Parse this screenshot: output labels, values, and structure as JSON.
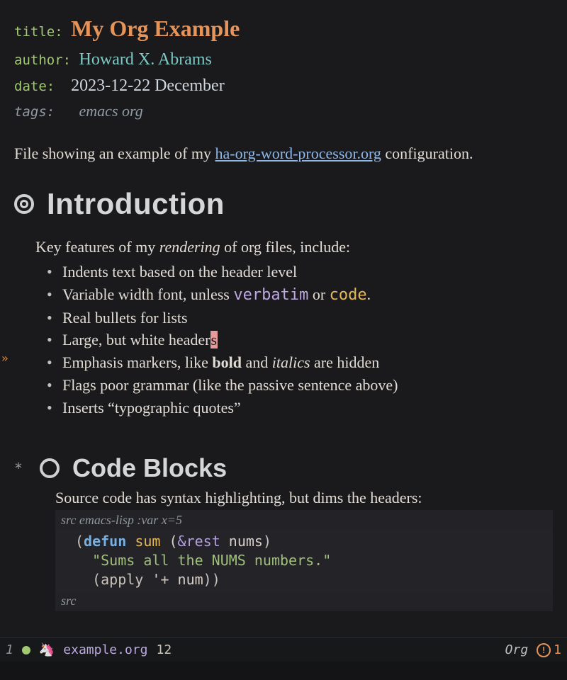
{
  "meta": {
    "title_key": "title",
    "title_val": "My Org Example",
    "author_key": "author",
    "author_val": "Howard X. Abrams",
    "date_key": "date",
    "date_val": "2023-12-22 December",
    "tags_key": "tags:",
    "tags_val": "emacs org"
  },
  "intro_para_pre": "File showing an example of my ",
  "intro_link": "ha-org-word-processor.org",
  "intro_para_post": " configuration.",
  "h1": "Introduction",
  "features_lead_pre": "Key features of my ",
  "features_lead_em": "rendering",
  "features_lead_post": " of org files, include:",
  "features": {
    "f0": "Indents text based on the header level",
    "f1_pre": "Variable width font, unless ",
    "f1_verb": "verbatim",
    "f1_mid": " or ",
    "f1_code": "code",
    "f1_post": ".",
    "f2": "Real bullets for lists",
    "f3_pre": "Large, but white header",
    "f3_cursor": "s",
    "f4_pre": "Emphasis markers, like ",
    "f4_bold": "bold",
    "f4_mid": " and ",
    "f4_ital": "italics",
    "f4_post": " are hidden",
    "f5": "Flags poor grammar (like the passive sentence above)",
    "f6": "Inserts “typographic quotes”"
  },
  "star": "*",
  "h2": "Code Blocks",
  "src_intro": "Source code has syntax highlighting, but dims the headers:",
  "src_header_prefix": "src",
  "src_header_lang": " emacs-lisp :var x=5",
  "src_footer": "src",
  "code": {
    "l1_open": "(",
    "l1_kw": "defun",
    "l1_sp": " ",
    "l1_fn": "sum",
    "l1_sp2": " (",
    "l1_amp": "&rest",
    "l1_sp3": " ",
    "l1_arg": "nums",
    "l1_close": ")",
    "l2": "\"Sums all the NUMS numbers.\"",
    "l3_open": "(",
    "l3_fn": "apply",
    "l3_sp": " '",
    "l3_plus": "+",
    "l3_sp2": " ",
    "l3_arg": "num",
    "l3_close": "))"
  },
  "modeline": {
    "win": "1",
    "file": "example.org",
    "line": "12",
    "mode": "Org",
    "warn_count": "1",
    "warn_glyph": "!"
  },
  "fringe_glyph": "»"
}
